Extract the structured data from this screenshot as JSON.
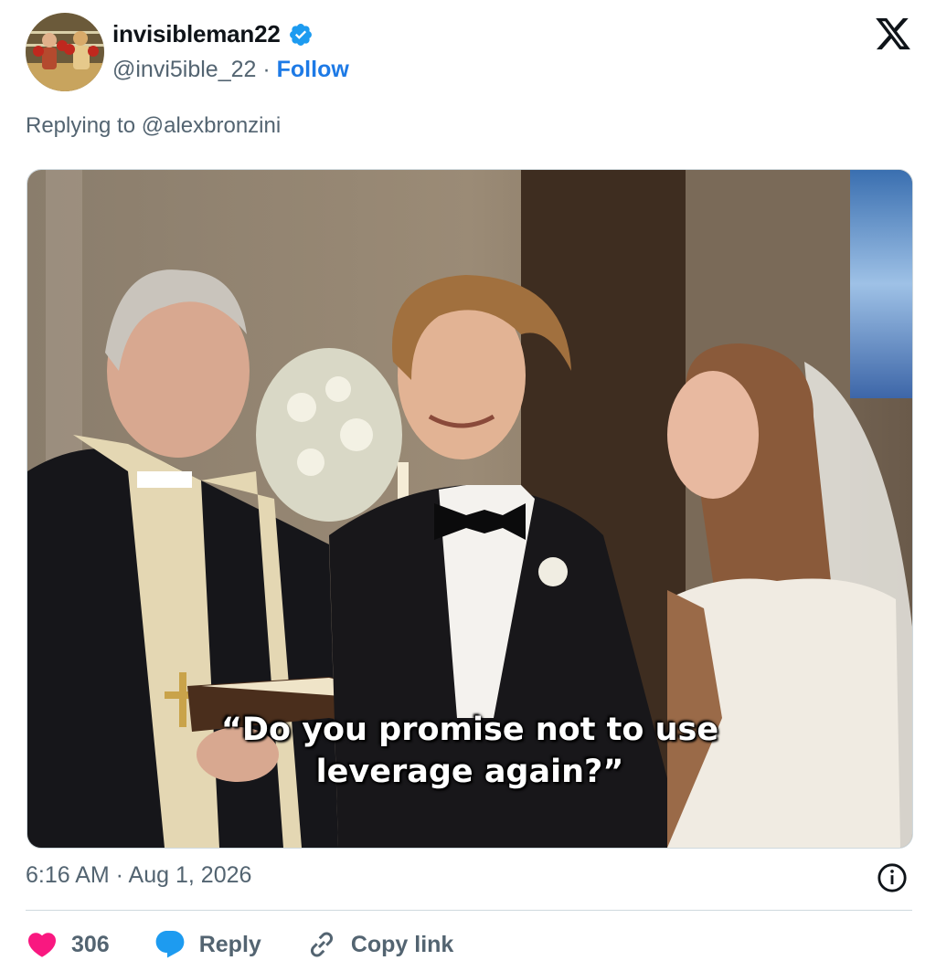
{
  "author": {
    "display_name": "invisibleman22",
    "handle": "@invi5ible_22",
    "separator": " · ",
    "follow_label": "Follow",
    "verified": true
  },
  "reply_to": "Replying to @alexbronzini",
  "media": {
    "caption_line1": "“Do you promise not to use",
    "caption_line2": "leverage again?”"
  },
  "timestamp": "6:16 AM · Aug 1, 2026",
  "actions": {
    "like_count": "306",
    "reply_label": "Reply",
    "copy_link_label": "Copy link"
  },
  "colors": {
    "accent": "#1d7ae6",
    "like": "#f91880",
    "reply": "#1d9bf0",
    "secondary_text": "#536471"
  },
  "icons": [
    "x-logo-icon",
    "verified-badge-icon",
    "info-icon",
    "heart-icon",
    "reply-bubble-icon",
    "link-icon"
  ]
}
